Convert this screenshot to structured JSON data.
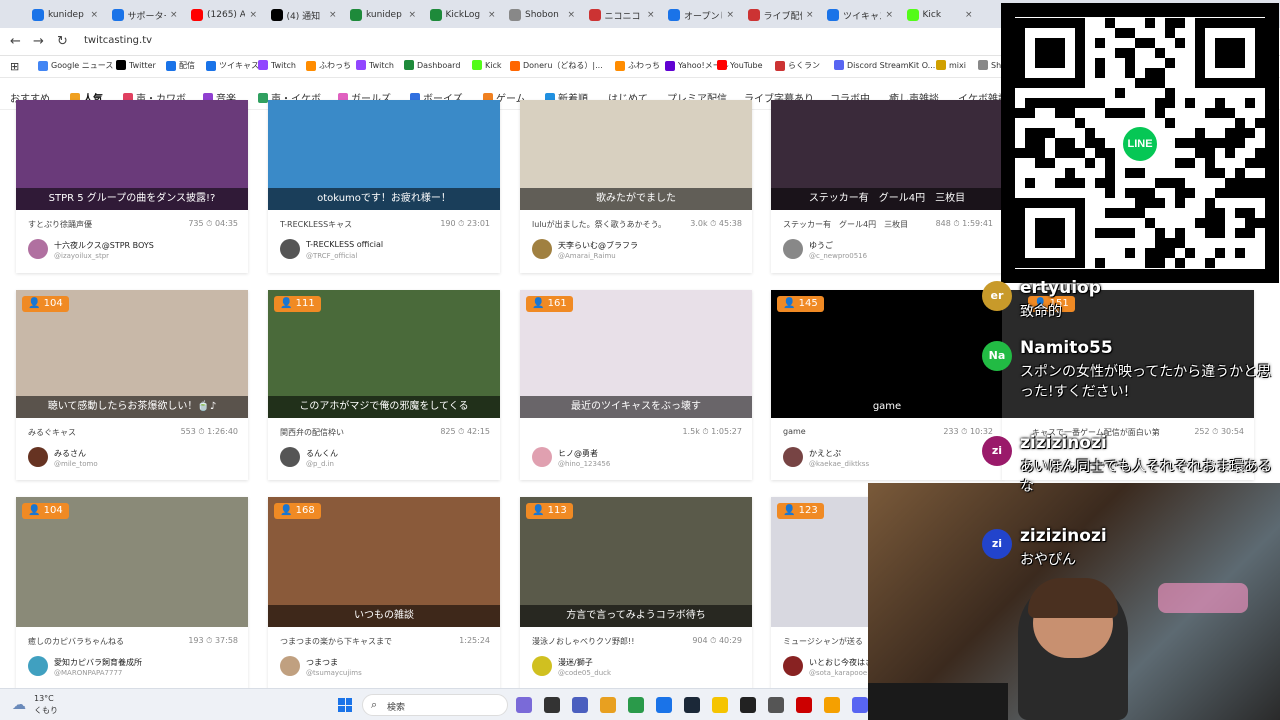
{
  "browser": {
    "tabs": [
      {
        "label": "kunidep",
        "color": "#1a73e8"
      },
      {
        "label": "サポーター",
        "color": "#1a73e8"
      },
      {
        "label": "(1265) A",
        "color": "#ff0000"
      },
      {
        "label": "(4) 通知",
        "color": "#000000"
      },
      {
        "label": "kunidep",
        "color": "#1e8a3a"
      },
      {
        "label": "KickLog",
        "color": "#1e8a3a"
      },
      {
        "label": "Shobon",
        "color": "#888888"
      },
      {
        "label": "ニコニコ",
        "color": "#cc3333"
      },
      {
        "label": "オープンし",
        "color": "#1a73e8"
      },
      {
        "label": "ライブ配信",
        "color": "#cc3333"
      },
      {
        "label": "ツイキャス",
        "color": "#1a73e8"
      },
      {
        "label": "Kick",
        "color": "#53fc18"
      }
    ],
    "url": "twitcasting.tv",
    "bookmarks": [
      {
        "label": "Google ニュース",
        "color": "#4285f4"
      },
      {
        "label": "Twitter",
        "color": "#000000"
      },
      {
        "label": "配信",
        "color": "#1a73e8"
      },
      {
        "label": "ツイキャス",
        "color": "#1a73e8"
      },
      {
        "label": "Twitch",
        "color": "#9146ff"
      },
      {
        "label": "ふわっち",
        "color": "#ff8c00"
      },
      {
        "label": "Twitch",
        "color": "#9146ff"
      },
      {
        "label": "Dashboard",
        "color": "#1e8a3a"
      },
      {
        "label": "Kick",
        "color": "#53fc18"
      },
      {
        "label": "Doneru（どねる）|...",
        "color": "#ff6600"
      },
      {
        "label": "ふわっち",
        "color": "#ff8c00"
      },
      {
        "label": "Yahoo!メール",
        "color": "#6001d2"
      },
      {
        "label": "YouTube",
        "color": "#ff0000"
      },
      {
        "label": "らくラン",
        "color": "#cc3333"
      },
      {
        "label": "Discord StreamKit O...",
        "color": "#5865f2"
      },
      {
        "label": "mixi",
        "color": "#d0a000"
      },
      {
        "label": "Sh",
        "color": "#888888"
      }
    ]
  },
  "categories": [
    {
      "label": "おすすめ",
      "color": ""
    },
    {
      "label": "人気",
      "color": "#f0a020",
      "active": true
    },
    {
      "label": "声・カワボ",
      "color": "#e04060"
    },
    {
      "label": "音楽",
      "color": "#9040d0"
    },
    {
      "label": "声・イケボ",
      "color": "#30a060"
    },
    {
      "label": "ガールズ",
      "color": "#e060c0"
    },
    {
      "label": "ボーイズ",
      "color": "#3070e0"
    },
    {
      "label": "ゲーム",
      "color": "#f08020"
    },
    {
      "label": "新着順",
      "color": "#2090e0"
    },
    {
      "label": "はじめて",
      "color": ""
    },
    {
      "label": "プレミア配信",
      "color": ""
    },
    {
      "label": "ライブ字幕あり",
      "color": ""
    },
    {
      "label": "コラボ中",
      "color": ""
    },
    {
      "label": "癒し声雑談",
      "color": ""
    },
    {
      "label": "イケボ雑談",
      "color": ""
    }
  ],
  "row1": [
    {
      "caption": "STPR 5 グループの曲をダンス披露!?",
      "desc": "すとぷり徐踊声優",
      "stats": "735 ⏱ 04:35",
      "name": "十六夜ルクス@STPR BOYS",
      "id": "@izayoilux_stpr",
      "bg": "#6a3a7a",
      "av": "#b070a0"
    },
    {
      "caption": "otokumoです！お疲れ様ー！",
      "desc": "T-RECKLESSキャス",
      "stats": "190 ⏱ 23:01",
      "name": "T-RECKLESS official",
      "id": "@TRCF_official",
      "bg": "#3a8ac8",
      "av": "#555555"
    },
    {
      "caption": "歌みたがでました",
      "desc": "luluが出ました。祭く歌うあかそう。",
      "stats": "3.0k ⏱ 45:38",
      "name": "天李らいむ@ブラフラ",
      "id": "@Amarai_Raimu",
      "bg": "#d8d0c0",
      "av": "#a08040"
    },
    {
      "caption": "ステッカー有　グール4円　三枚目",
      "desc": "ステッカー有　グール4円　三枚目",
      "stats": "848 ⏱ 1:59:41",
      "name": "ゆうご",
      "id": "@c_newpro0516",
      "bg": "#3a2a3a",
      "av": "#888888"
    }
  ],
  "row2": [
    {
      "viewers": "104",
      "caption": "聴いて感動したらお茶爆欲しい！🍵♪",
      "desc": "みるぐキャス",
      "stats": "553 ⏱ 1:26:40",
      "name": "みるさん",
      "id": "@mile_tomo",
      "bg": "#c8b8a8",
      "av": "#663322"
    },
    {
      "viewers": "111",
      "caption": "このアホがマジで俺の邪魔をしてくる",
      "desc": "関西弁の配信枠い",
      "stats": "825 ⏱ 42:15",
      "name": "るんくん",
      "id": "@p_d.in",
      "bg": "#4a6a3a",
      "av": "#555555"
    },
    {
      "viewers": "161",
      "caption": "最近のツイキャスをぶっ壊す",
      "desc": "",
      "stats": "1.5k ⏱ 1:05:27",
      "name": "ヒノ@勇者",
      "id": "@hino_123456",
      "bg": "#e8e0e8",
      "av": "#e0a0b0"
    },
    {
      "viewers": "145",
      "caption": "game",
      "desc": "game",
      "stats": "233 ⏱ 10:32",
      "name": "かえとぷ",
      "id": "@kaekae_diktkss",
      "bg": "#000000",
      "av": "#774444"
    }
  ],
  "row3": [
    {
      "viewers": "104",
      "caption": "",
      "desc": "癒しのカピバラちゃんねる",
      "stats": "193 ⏱ 37:58",
      "name": "愛知カピバラ飼育養成所",
      "id": "@MARONPAPA7777",
      "bg": "#8a8a78",
      "av": "#40a0c0"
    },
    {
      "viewers": "168",
      "caption": "いつもの雑談",
      "desc": "つまつまの楽から下キャスまで",
      "stats": "1:25:24",
      "name": "つまつま",
      "id": "@tsumaycujims",
      "bg": "#8a5a3a",
      "av": "#c0a080"
    },
    {
      "viewers": "113",
      "caption": "方言で言ってみようコラボ待ち",
      "desc": "漫泳ノおしゃべりクソ野郎!!",
      "stats": "904 ⏱ 40:29",
      "name": "漫迷/獅子",
      "id": "@code05_duck",
      "bg": "#5a5a4a",
      "av": "#d0c020"
    },
    {
      "viewers": "123",
      "caption": "",
      "desc": "ミュージシャンが送る",
      "stats": "",
      "name": "いとおじ今夜はさ",
      "id": "@sota_karapooe",
      "bg": "#d8d8e0",
      "av": "#882222"
    }
  ],
  "overlay_cards": [
    {
      "viewers": "151",
      "desc": "キャスで一番ゲーム配信が面白い第",
      "stats": "252 ⏱ 30:54",
      "id": "@c:kanaalkyuns"
    }
  ],
  "chat": [
    {
      "initials": "er",
      "name": "ertyuiop",
      "msg": "致命的",
      "color": "#c89a2a"
    },
    {
      "initials": "Na",
      "name": "Namito55",
      "msg": "スポンの女性が映ってたから違うかと思った!すください!",
      "color": "#22bb44"
    },
    {
      "initials": "zi",
      "name": "zizizinozi",
      "msg": "あいほん同士でも人それぞれおま環あるな",
      "color": "#9a1a6a"
    },
    {
      "initials": "zi",
      "name": "zizizinozi",
      "msg": "おやぴん",
      "color": "#2244cc"
    }
  ],
  "taskbar": {
    "weather_temp": "13°C",
    "weather_desc": "くもり",
    "search_placeholder": "検索"
  }
}
